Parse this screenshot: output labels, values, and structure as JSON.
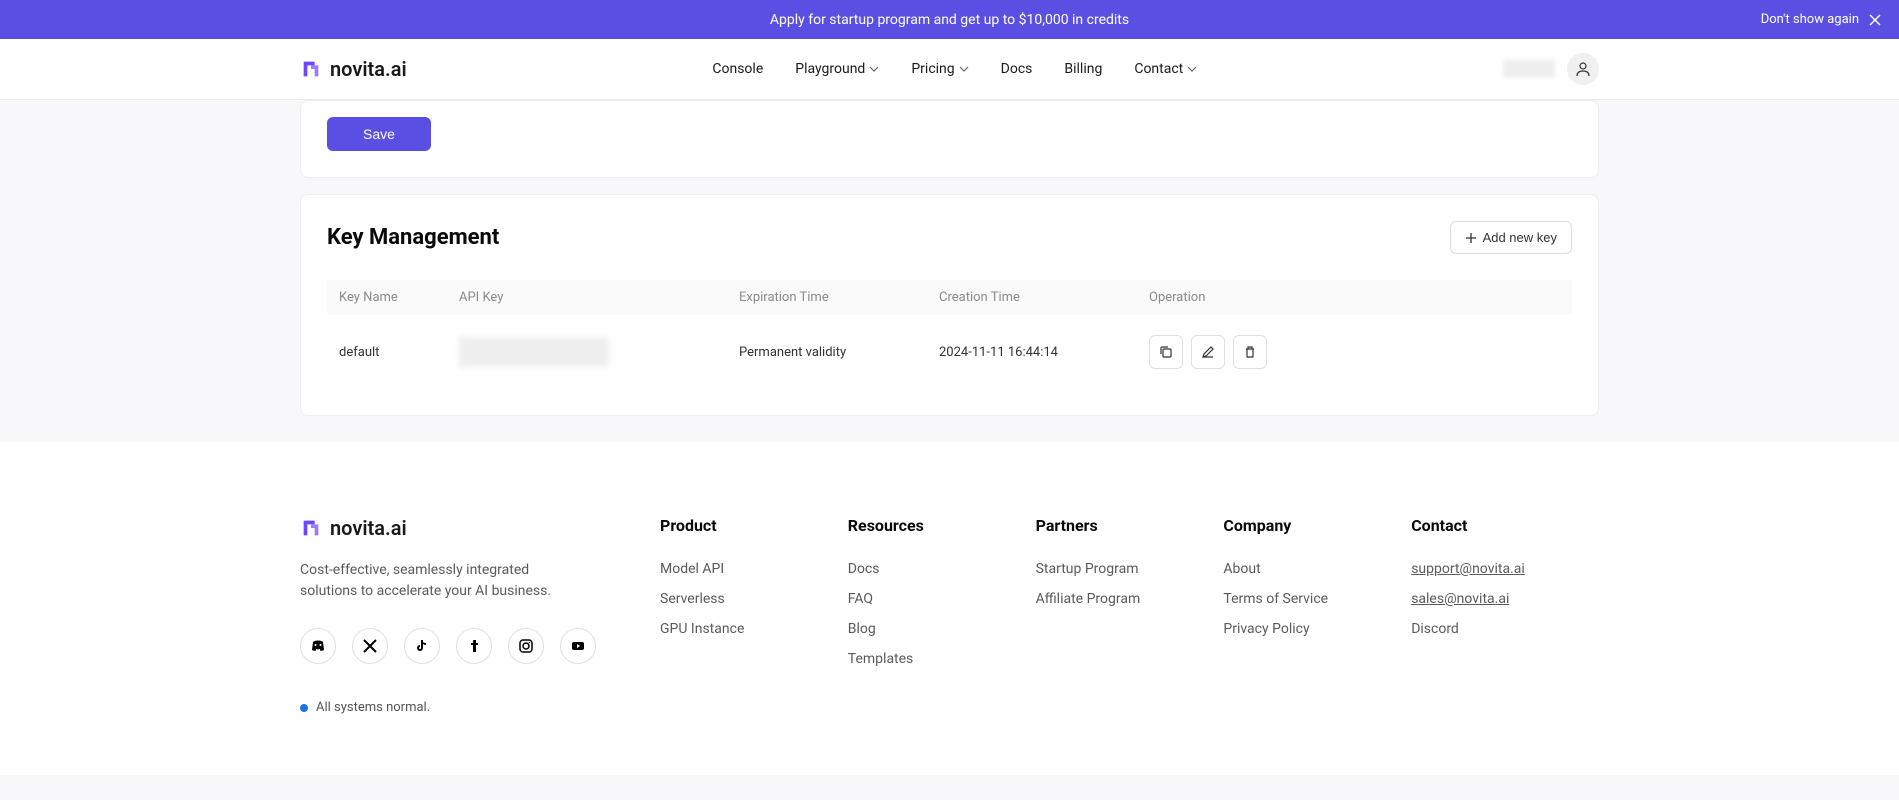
{
  "banner": {
    "text": "Apply for startup program and get up to $10,000 in credits",
    "dismiss": "Don't show again"
  },
  "brand": "novita.ai",
  "nav": {
    "console": "Console",
    "playground": "Playground",
    "pricing": "Pricing",
    "docs": "Docs",
    "billing": "Billing",
    "contact": "Contact"
  },
  "save": {
    "button": "Save"
  },
  "keys": {
    "title": "Key Management",
    "add_button": "Add new key",
    "columns": {
      "name": "Key Name",
      "api_key": "API Key",
      "expiration": "Expiration Time",
      "creation": "Creation Time",
      "operation": "Operation"
    },
    "rows": [
      {
        "name": "default",
        "expiration": "Permanent validity",
        "creation": "2024-11-11 16:44:14"
      }
    ]
  },
  "footer": {
    "tagline": "Cost-effective, seamlessly integrated solutions to accelerate your AI business.",
    "status": "All systems normal.",
    "columns": {
      "product": {
        "title": "Product",
        "links": {
          "model_api": "Model API",
          "serverless": "Serverless",
          "gpu": "GPU Instance"
        }
      },
      "resources": {
        "title": "Resources",
        "links": {
          "docs": "Docs",
          "faq": "FAQ",
          "blog": "Blog",
          "templates": "Templates"
        }
      },
      "partners": {
        "title": "Partners",
        "links": {
          "startup": "Startup Program",
          "affiliate": "Affiliate Program"
        }
      },
      "company": {
        "title": "Company",
        "links": {
          "about": "About",
          "tos": "Terms of Service",
          "privacy": "Privacy Policy"
        }
      },
      "contact": {
        "title": "Contact",
        "links": {
          "support": "support@novita.ai",
          "sales": "sales@novita.ai",
          "discord": "Discord"
        }
      }
    }
  }
}
